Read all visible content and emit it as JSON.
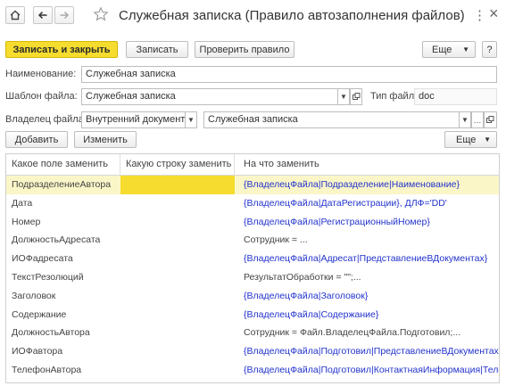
{
  "window": {
    "title": "Служебная записка (Правило автозаполнения файлов)",
    "more_menu": "⋮",
    "close": "×"
  },
  "toolbar": {
    "save_close": "Записать и закрыть",
    "save": "Записать",
    "check_rule": "Проверить правило",
    "more": "Еще",
    "help": "?"
  },
  "form": {
    "name_label": "Наименование:",
    "name_value": "Служебная записка",
    "template_label": "Шаблон файла:",
    "template_value": "Служебная записка",
    "filetype_label": "Тип файла:",
    "filetype_value": "doc",
    "owner_label": "Владелец файла:",
    "owner_type_value": "Внутренний документ",
    "owner_value": "Служебная записка"
  },
  "table_toolbar": {
    "add": "Добавить",
    "change": "Изменить",
    "more": "Еще"
  },
  "table": {
    "columns": [
      "Какое поле заменить",
      "Какую строку заменить",
      "На что заменить"
    ],
    "rows": [
      {
        "field": "ПодразделениеАвтора",
        "string": "",
        "replace": "{ВладелецФайла|Подразделение|Наименование}",
        "style": "blue"
      },
      {
        "field": "Дата",
        "string": "",
        "replace": "{ВладелецФайла|ДатаРегистрации}, ДЛФ='DD'",
        "style": "blue"
      },
      {
        "field": "Номер",
        "string": "",
        "replace": "{ВладелецФайла|РегистрационныйНомер}",
        "style": "blue"
      },
      {
        "field": "ДолжностьАдресата",
        "string": "",
        "replace": "Сотрудник = ...",
        "style": "gray"
      },
      {
        "field": "ИОФадресата",
        "string": "",
        "replace": "{ВладелецФайла|Адресат|ПредставлениеВДокументах}",
        "style": "blue"
      },
      {
        "field": "ТекстРезолюций",
        "string": "",
        "replace": "РезультатОбработки = \"\";...",
        "style": "gray"
      },
      {
        "field": "Заголовок",
        "string": "",
        "replace": "{ВладелецФайла|Заголовок}",
        "style": "blue"
      },
      {
        "field": "Содержание",
        "string": "",
        "replace": "{ВладелецФайла|Содержание}",
        "style": "blue"
      },
      {
        "field": "ДолжностьАвтора",
        "string": "",
        "replace": "Сотрудник = Файл.ВладелецФайла.Подготовил;...",
        "style": "gray"
      },
      {
        "field": "ИОФавтора",
        "string": "",
        "replace": "{ВладелецФайла|Подготовил|ПредставлениеВДокументах}",
        "style": "blue"
      },
      {
        "field": "ТелефонАвтора",
        "string": "",
        "replace": "{ВладелецФайла|Подготовил|КонтактнаяИнформация|Телефон}",
        "style": "blue"
      }
    ]
  },
  "colors": {
    "accent_yellow": "#f5dc2e",
    "selected_row": "#fbf6c8",
    "link_blue": "#2233cc"
  },
  "icons": [
    "home-icon",
    "back-arrow-icon",
    "forward-arrow-icon",
    "star-icon",
    "dropdown-icon",
    "copy-icon",
    "ellipsis-icon"
  ]
}
